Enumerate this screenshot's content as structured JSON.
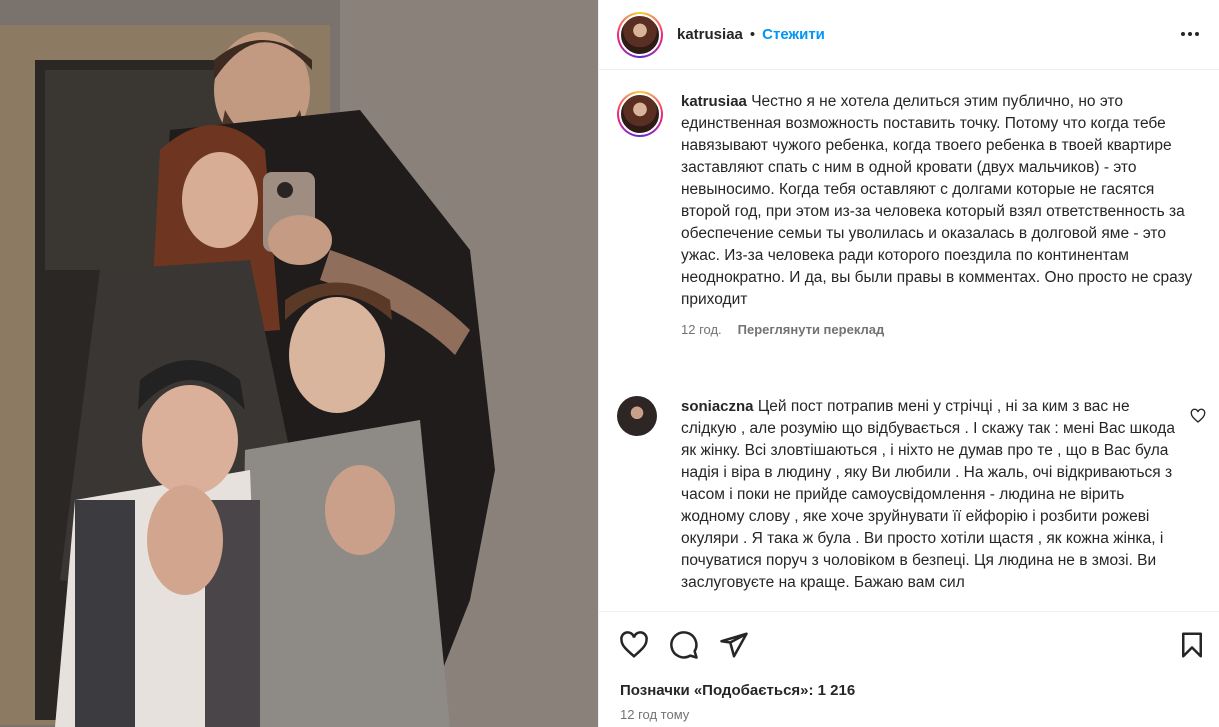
{
  "post": {
    "photo_alt": "Family selfie in mirror",
    "author": "katrusiaa",
    "separator": "•",
    "follow_label": "Стежити"
  },
  "caption": {
    "username": "katrusiaa",
    "text": "Честно я не хотела делиться этим публично, но это единственная возможность поставить точку. Потому что когда тебе навязывают чужого ребенка, когда твоего ребенка в твоей квартире заставляют спать с ним в одной кровати (двух мальчиков) - это невыносимо. Когда тебя оставляют с долгами которые не гасятся второй год, при этом из-за человека который взял ответственность за обеспечение семьи ты уволилась и оказалась в долговой яме - это ужас. Из-за человека ради которого поездила по континентам неоднократно. И да, вы были правы в комментах. Оно просто не сразу приходит",
    "age": "12 год.",
    "translate_label": "Переглянути переклад"
  },
  "comment": {
    "username": "soniaczna",
    "text": "Цей пост потрапив мені у стрічці , ні за ким з вас не слідкую , але розумію що відбувається . І скажу так : мені Вас шкода як жінку. Всі зловтішаються , і ніхто не думав про те , що в Вас була надія і віра в людину , яку Ви любили . На жаль, очі відкриваються з часом і поки не прийде самоусвідомлення - людина не вірить жодному слову , яке хоче зруйнувати її ейфорію і розбити рожеві окуляри . Я така ж була . Ви просто хотіли щастя , як кожна жінка, і почуватися поруч з чоловіком в безпеці. Ця людина не в змозі. Ви заслуговуєте на краще. Бажаю вам сил"
  },
  "actions": {
    "icons": [
      "heart-icon",
      "comment-icon",
      "share-icon",
      "bookmark-icon"
    ]
  },
  "likes": {
    "label": "Позначки «Подобається»: 1 216"
  },
  "timestamp": "12 год тому"
}
